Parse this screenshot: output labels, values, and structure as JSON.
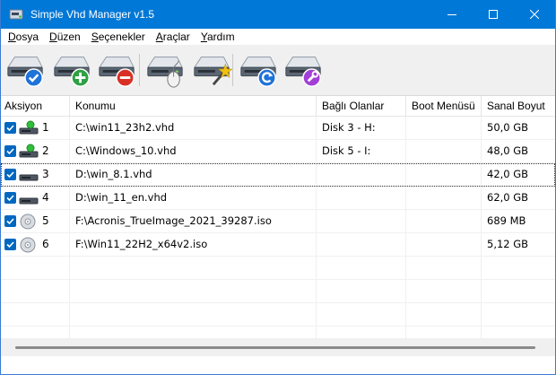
{
  "window": {
    "title": "Simple Vhd Manager v1.5"
  },
  "menu": [
    {
      "label": "Dosya",
      "mn": "D",
      "rest": "osya"
    },
    {
      "label": "Düzen",
      "mn": "D",
      "rest": "üzen"
    },
    {
      "label": "Seçenekler",
      "mn": "S",
      "rest": "eçenekler"
    },
    {
      "label": "Araçlar",
      "mn": "A",
      "rest": "raçlar"
    },
    {
      "label": "Yardım",
      "mn": "Y",
      "rest": "ardım"
    }
  ],
  "toolbar": [
    "drive-check-icon",
    "drive-add-icon",
    "drive-remove-icon",
    "drive-mouse-icon",
    "drive-wand-icon",
    "drive-refresh-icon",
    "drive-tools-icon"
  ],
  "columns": [
    "Aksiyon",
    "Konumu",
    "Bağlı Olanlar",
    "Boot Menüsü",
    "Sanal Boyut"
  ],
  "rows": [
    {
      "num": "1",
      "path": "C:\\win11_23h2.vhd",
      "mounted": "Disk 3  -  H:",
      "boot": "",
      "size": "50,0 GB",
      "icon": "hdd-mounted"
    },
    {
      "num": "2",
      "path": "C:\\Windows_10.vhd",
      "mounted": "Disk 5  -  I:",
      "boot": "",
      "size": "48,0 GB",
      "icon": "hdd-mounted"
    },
    {
      "num": "3",
      "path": "D:\\win_8.1.vhd",
      "mounted": "",
      "boot": "",
      "size": "42,0 GB",
      "icon": "hdd"
    },
    {
      "num": "4",
      "path": "D:\\win_11_en.vhd",
      "mounted": "",
      "boot": "",
      "size": "62,0 GB",
      "icon": "hdd"
    },
    {
      "num": "5",
      "path": "F:\\Acronis_TrueImage_2021_39287.iso",
      "mounted": "",
      "boot": "",
      "size": "689 MB",
      "icon": "disc"
    },
    {
      "num": "6",
      "path": "F:\\Win11_22H2_x64v2.iso",
      "mounted": "",
      "boot": "",
      "size": "5,12 GB",
      "icon": "disc"
    }
  ],
  "empty_rows": 4,
  "colors": {
    "accent": "#0078d7",
    "check": "#0067c0"
  }
}
